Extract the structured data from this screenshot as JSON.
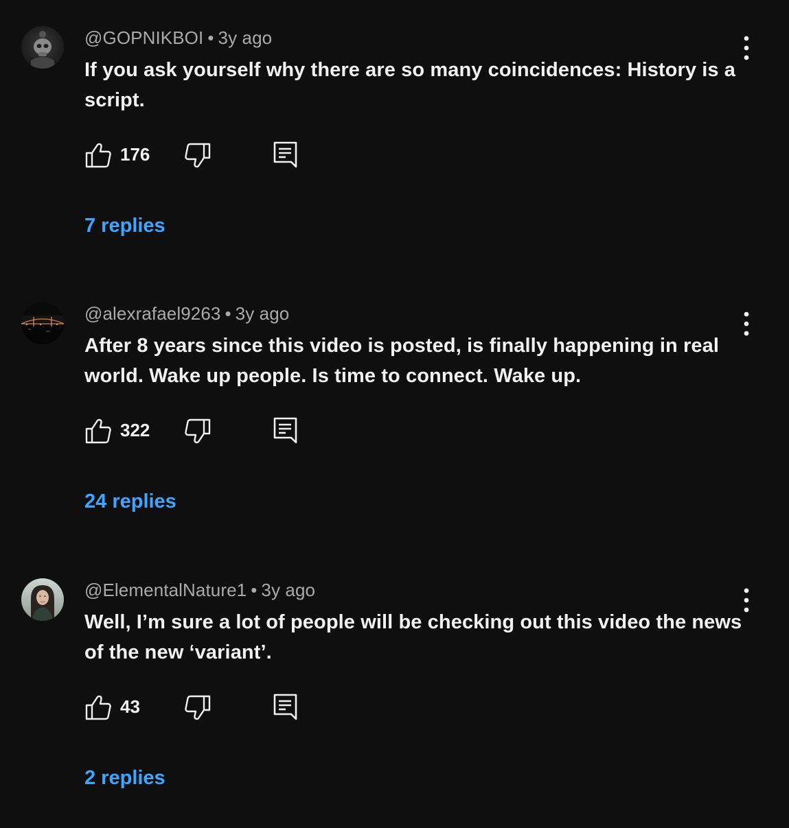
{
  "comments": [
    {
      "author": "@GOPNIKBOI",
      "separator": "•",
      "time": "3y ago",
      "text": "If you ask yourself why there are so many coincidences: History is a script.",
      "likes": "176",
      "replies_label": "7 replies",
      "avatar_icon": "skull-avatar-icon"
    },
    {
      "author": "@alexrafael9263",
      "separator": "•",
      "time": "3y ago",
      "text": "After 8 years since this video is posted, is finally happening in real world. Wake up people. Is time to connect. Wake up.",
      "likes": "322",
      "replies_label": "24 replies",
      "avatar_icon": "night-bridge-avatar-icon"
    },
    {
      "author": "@ElementalNature1",
      "separator": "•",
      "time": "3y ago",
      "text": "Well, I’m sure a lot of people will be checking out this video the news of the new ‘variant’.",
      "likes": "43",
      "replies_label": "2 replies",
      "avatar_icon": "woman-portrait-avatar-icon"
    }
  ],
  "colors": {
    "background": "#0f0f0f",
    "text_primary": "#f1f1f1",
    "text_secondary": "#aaaaaa",
    "link": "#3ea6ff"
  },
  "icons": {
    "like": "thumbs-up-icon",
    "dislike": "thumbs-down-icon",
    "reply": "reply-comment-icon",
    "more": "more-vertical-icon"
  }
}
